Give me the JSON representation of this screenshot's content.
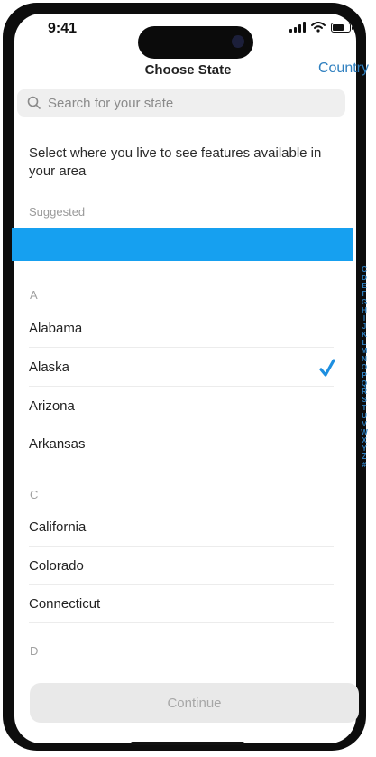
{
  "status": {
    "time": "9:41"
  },
  "nav": {
    "title": "Choose State",
    "action_label": "Country"
  },
  "search": {
    "placeholder": "Search for your state"
  },
  "intro_text": "Select where you live to see features available in your area",
  "suggested": {
    "label": "Suggested"
  },
  "sections": [
    {
      "letter": "A",
      "items": [
        "Alabama",
        "Alaska",
        "Arizona",
        "Arkansas"
      ]
    },
    {
      "letter": "C",
      "items": [
        "California",
        "Colorado",
        "Connecticut"
      ]
    },
    {
      "letter": "D",
      "items": []
    }
  ],
  "selected_state": "Alaska",
  "index_letters": [
    "C",
    "D",
    "E",
    "F",
    "G",
    "H",
    "I",
    "J",
    "K",
    "L",
    "M",
    "N",
    "O",
    "P",
    "Q",
    "R",
    "S",
    "T",
    "U",
    "V",
    "W",
    "X",
    "Y",
    "Z",
    "#"
  ],
  "continue_label": "Continue",
  "colors": {
    "accent": "#2e7fbf",
    "suggested_bar": "#16a0f0",
    "check": "#1e8fe0"
  }
}
